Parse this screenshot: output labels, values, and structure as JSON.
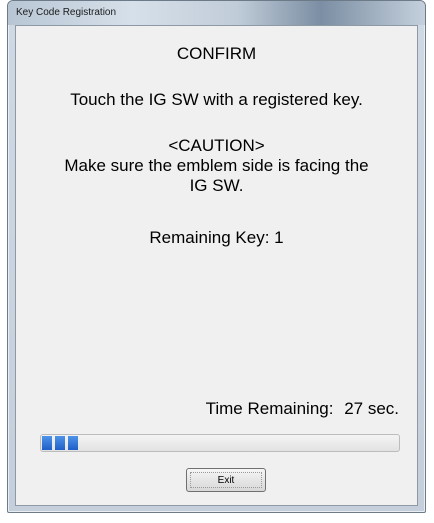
{
  "window": {
    "title": "Key Code Registration"
  },
  "dialog": {
    "heading": "CONFIRM",
    "instruction": "Touch the IG SW with a registered key.",
    "caution_heading": "<CAUTION>",
    "caution_line_1": "Make sure the emblem side is facing the",
    "caution_line_2": "IG SW.",
    "remaining_key": "Remaining Key: 1",
    "time_label": "Time Remaining:",
    "time_value": "27 sec."
  },
  "progress": {
    "filled_segments": 3,
    "fraction": 0.1,
    "color": "#2a6fd6"
  },
  "buttons": {
    "exit_label": "Exit"
  }
}
